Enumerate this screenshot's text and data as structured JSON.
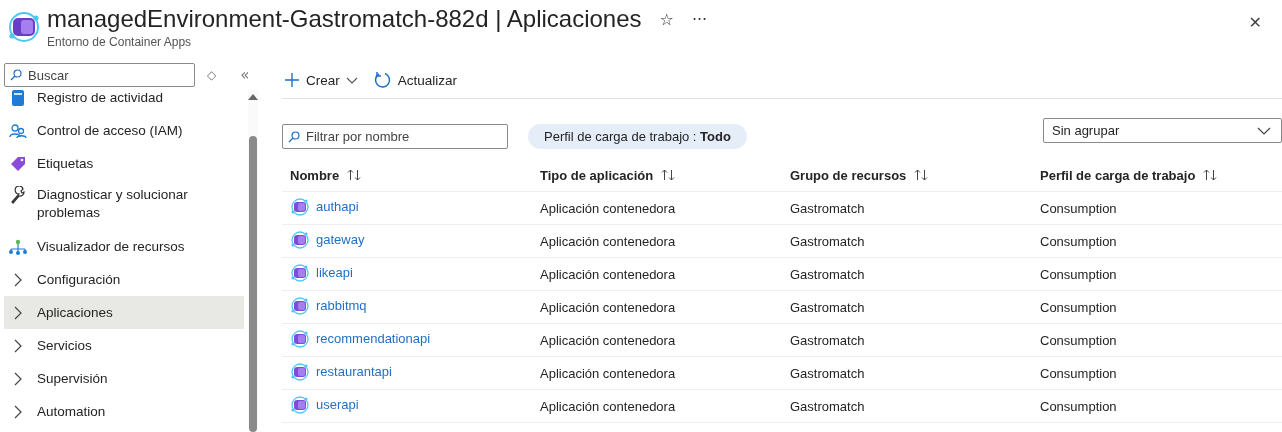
{
  "header": {
    "title": "managedEnvironment-Gastromatch-882d | Aplicaciones",
    "subtitle": "Entorno de Container Apps",
    "star": "☆",
    "more": "···",
    "close": "✕"
  },
  "sidebar": {
    "search": {
      "placeholder": "Buscar"
    },
    "updown": "◇",
    "collapse": "«",
    "items": [
      {
        "label": "Registro de actividad",
        "kind": "log",
        "selected": false
      },
      {
        "label": "Control de acceso (IAM)",
        "kind": "people",
        "selected": false
      },
      {
        "label": "Etiquetas",
        "kind": "tag",
        "selected": false
      },
      {
        "label": "Diagnosticar y solucionar problemas",
        "kind": "wrench",
        "selected": false
      },
      {
        "label": "Visualizador de recursos",
        "kind": "tree",
        "selected": false
      },
      {
        "label": "Configuración",
        "kind": "group",
        "selected": false
      },
      {
        "label": "Aplicaciones",
        "kind": "group",
        "selected": true
      },
      {
        "label": "Servicios",
        "kind": "group",
        "selected": false
      },
      {
        "label": "Supervisión",
        "kind": "group",
        "selected": false
      },
      {
        "label": "Automation",
        "kind": "group",
        "selected": false
      }
    ]
  },
  "toolbar": [
    {
      "label": "Crear",
      "kind": "create"
    },
    {
      "label": "Actualizar",
      "kind": "refresh"
    }
  ],
  "filter": {
    "placeholder": "Filtrar por nombre"
  },
  "pill": {
    "text": "Perfil de carga de trabajo : **Todo**"
  },
  "grouping": {
    "value": "Sin agrupar"
  },
  "table": {
    "columns": [
      "Nombre",
      "Tipo de aplicación",
      "Grupo de recursos",
      "Perfil de carga de trabajo"
    ],
    "rows": [
      [
        "authapi",
        "Aplicación contenedora",
        "Gastromatch",
        "Consumption"
      ],
      [
        "gateway",
        "Aplicación contenedora",
        "Gastromatch",
        "Consumption"
      ],
      [
        "likeapi",
        "Aplicación contenedora",
        "Gastromatch",
        "Consumption"
      ],
      [
        "rabbitmq",
        "Aplicación contenedora",
        "Gastromatch",
        "Consumption"
      ],
      [
        "recommendationapi",
        "Aplicación contenedora",
        "Gastromatch",
        "Consumption"
      ],
      [
        "restaurantapi",
        "Aplicación contenedora",
        "Gastromatch",
        "Consumption"
      ],
      [
        "userapi",
        "Aplicación contenedora",
        "Gastromatch",
        "Consumption"
      ]
    ]
  }
}
